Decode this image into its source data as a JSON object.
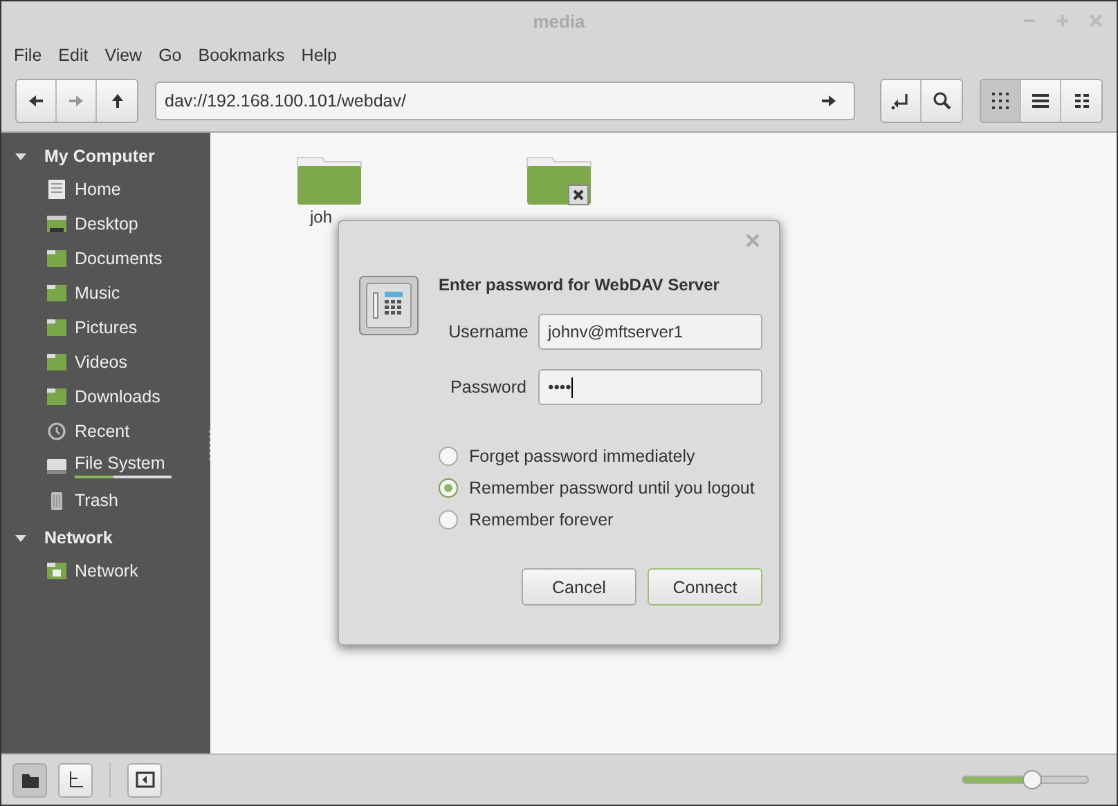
{
  "window": {
    "title": "media"
  },
  "menu": [
    "File",
    "Edit",
    "View",
    "Go",
    "Bookmarks",
    "Help"
  ],
  "location": {
    "value": "dav://192.168.100.101/webdav/"
  },
  "view_buttons": [
    {
      "kind": "icons",
      "selected": true
    },
    {
      "kind": "list",
      "selected": false
    },
    {
      "kind": "compact",
      "selected": false
    }
  ],
  "sidebar": {
    "sections": [
      {
        "title": "My Computer",
        "expanded": true,
        "items": [
          {
            "label": "Home",
            "kind": "home"
          },
          {
            "label": "Desktop",
            "kind": "desktop"
          },
          {
            "label": "Documents",
            "kind": "folder"
          },
          {
            "label": "Music",
            "kind": "folder"
          },
          {
            "label": "Pictures",
            "kind": "folder"
          },
          {
            "label": "Videos",
            "kind": "folder"
          },
          {
            "label": "Downloads",
            "kind": "folder"
          },
          {
            "label": "Recent",
            "kind": "recent"
          },
          {
            "label": "File System",
            "kind": "drive",
            "level": 0.4
          },
          {
            "label": "Trash",
            "kind": "trash"
          }
        ]
      },
      {
        "title": "Network",
        "expanded": true,
        "items": [
          {
            "label": "Network",
            "kind": "network"
          }
        ]
      }
    ]
  },
  "files": [
    {
      "name": "joh",
      "unmounted": false
    },
    {
      "unmounted": true
    }
  ],
  "dialog": {
    "title": "Enter password for WebDAV Server",
    "fields": [
      {
        "label": "Username",
        "value": "johnv@mftserver1"
      },
      {
        "label": "Password",
        "value": "••••"
      }
    ],
    "options": [
      {
        "label": "Forget password immediately",
        "selected": false
      },
      {
        "label": "Remember password until you logout",
        "selected": true
      },
      {
        "label": "Remember forever",
        "selected": false
      }
    ],
    "buttons": [
      {
        "label": "Cancel",
        "default": false
      },
      {
        "label": "Connect",
        "default": true
      }
    ]
  },
  "bottom_bar": {
    "pane_buttons": [
      {
        "kind": "places",
        "selected": true
      },
      {
        "kind": "tree",
        "selected": false
      }
    ],
    "zoom": {
      "level": 0.55
    }
  }
}
